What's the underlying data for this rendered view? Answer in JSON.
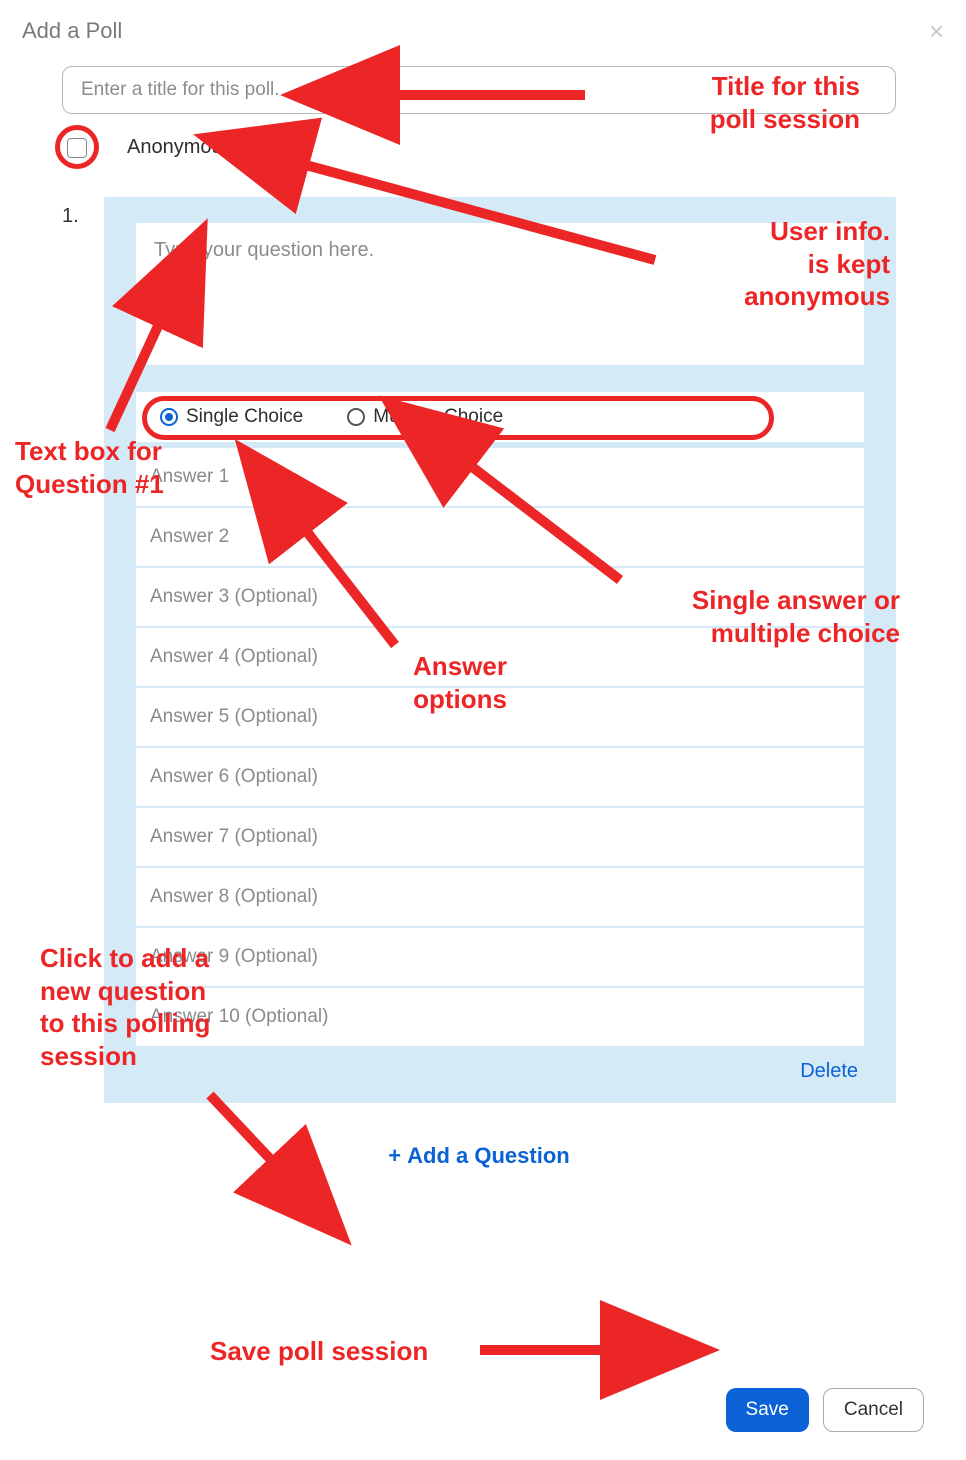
{
  "header": {
    "title": "Add a Poll",
    "close_glyph": "×"
  },
  "title_placeholder": "Enter a title for this poll.",
  "anonymous": {
    "label": "Anonymous?",
    "help_glyph": "?"
  },
  "question": {
    "number": "1.",
    "placeholder": "Type your question here.",
    "choice_single": "Single Choice",
    "choice_multiple": "Multiple Choice",
    "answers": [
      "Answer 1",
      "Answer 2",
      "Answer 3 (Optional)",
      "Answer 4 (Optional)",
      "Answer 5 (Optional)",
      "Answer 6 (Optional)",
      "Answer 7 (Optional)",
      "Answer 8 (Optional)",
      "Answer 9 (Optional)",
      "Answer 10 (Optional)"
    ],
    "delete_label": "Delete"
  },
  "add_question": {
    "plus": "+",
    "label": "Add a Question"
  },
  "footer": {
    "save": "Save",
    "cancel": "Cancel"
  },
  "annotations": {
    "title": "Title for this\npoll session",
    "anon": "User info.\nis kept\nanonymous",
    "qtext": "Text box for\nQuestion #1",
    "choice": "Single answer or\nmultiple choice",
    "answers": "Answer\noptions",
    "addq": "Click to add a\nnew question\nto this polling\nsession",
    "save": "Save poll session"
  }
}
